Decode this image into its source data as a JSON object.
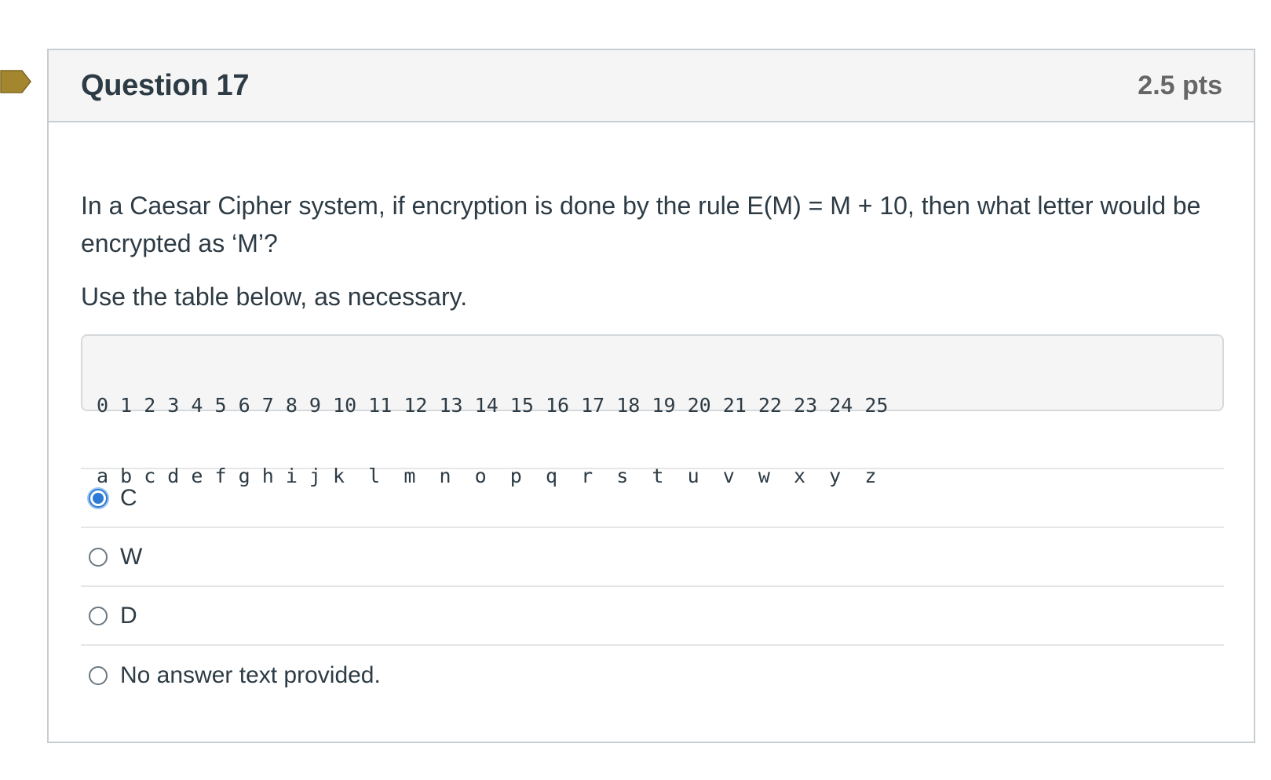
{
  "flag": {
    "icon": "bookmark-flag-icon",
    "color": "#a3862d"
  },
  "question": {
    "title": "Question 17",
    "points": "2.5 pts",
    "text": "In a Caesar Cipher system, if encryption is done by the rule E(M) = M + 10, then what letter would be encrypted as ‘M’?",
    "instructions": "Use the table below, as necessary.",
    "table": {
      "numbers_line": "0 1 2 3 4 5 6 7 8 9 10 11 12 13 14 15 16 17 18 19 20 21 22 23 24 25",
      "letters_line": "a b c d e f g h i j k  l  m  n  o  p  q  r  s  t  u  v  w  x  y  z"
    }
  },
  "answers": [
    {
      "label": "C",
      "selected": true
    },
    {
      "label": "W",
      "selected": false
    },
    {
      "label": "D",
      "selected": false
    },
    {
      "label": "No answer text provided.",
      "selected": false
    }
  ],
  "colors": {
    "accent": "#2b7bd6",
    "header_bg": "#f5f5f5",
    "border": "#c7cdd1",
    "text": "#2d3b45",
    "points_text": "#666666"
  }
}
